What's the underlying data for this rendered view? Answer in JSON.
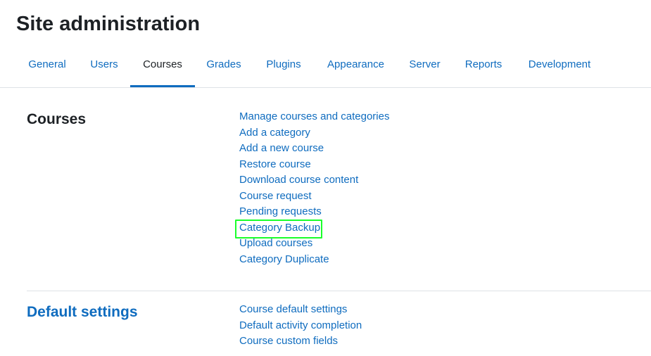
{
  "page": {
    "title": "Site administration"
  },
  "tabs": [
    {
      "label": "General"
    },
    {
      "label": "Users"
    },
    {
      "label": "Courses",
      "active": true
    },
    {
      "label": "Grades"
    },
    {
      "label": "Plugins"
    },
    {
      "label": "Appearance"
    },
    {
      "label": "Server"
    },
    {
      "label": "Reports"
    },
    {
      "label": "Development"
    }
  ],
  "sections": [
    {
      "heading": "Courses",
      "links": [
        "Manage courses and categories",
        "Add a category",
        "Add a new course",
        "Restore course",
        "Download course content",
        "Course request",
        "Pending requests",
        "Category Backup",
        "Upload courses",
        "Category Duplicate"
      ]
    },
    {
      "heading": "Default settings",
      "links": [
        "Course default settings",
        "Default activity completion",
        "Course custom fields"
      ]
    }
  ],
  "colors": {
    "link": "#0f6cbf",
    "text": "#1d2125",
    "highlight": "#1aff2b",
    "divider": "#dee2e6"
  }
}
